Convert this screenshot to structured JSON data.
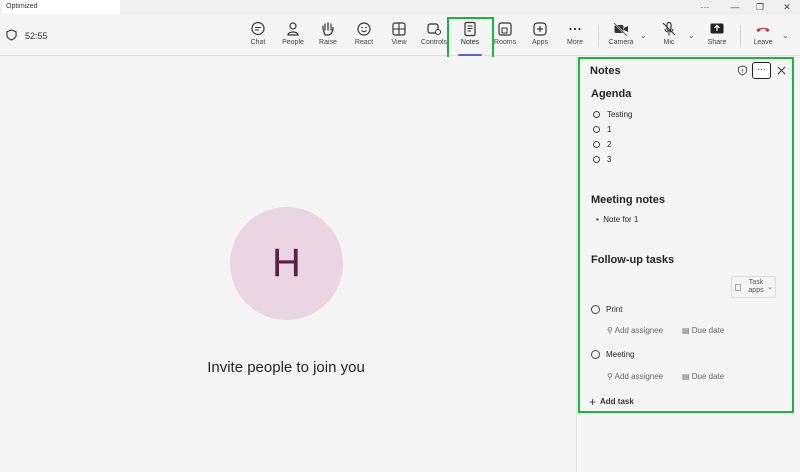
{
  "window": {
    "title": "Optimized",
    "controls": [
      "···",
      "—",
      "❐",
      "✕"
    ]
  },
  "meeting": {
    "timer": "52:55"
  },
  "toolbar": {
    "buttons": [
      {
        "name": "chat",
        "label": "Chat",
        "icon": "chat-icon"
      },
      {
        "name": "people",
        "label": "People",
        "icon": "people-icon"
      },
      {
        "name": "raise",
        "label": "Raise",
        "icon": "hand-icon"
      },
      {
        "name": "react",
        "label": "React",
        "icon": "smile-icon"
      },
      {
        "name": "view",
        "label": "View",
        "icon": "grid-icon"
      },
      {
        "name": "controls",
        "label": "Controls",
        "icon": "controls-icon"
      },
      {
        "name": "notes",
        "label": "Notes",
        "icon": "notes-icon",
        "active": true
      },
      {
        "name": "rooms",
        "label": "Rooms",
        "icon": "rooms-icon"
      },
      {
        "name": "apps",
        "label": "Apps",
        "icon": "plus-icon"
      },
      {
        "name": "more",
        "label": "More",
        "icon": "ellipsis-icon"
      },
      {
        "name": "camera",
        "label": "Camera",
        "icon": "camera-off-icon"
      },
      {
        "name": "mic",
        "label": "Mic",
        "icon": "mic-off-icon"
      },
      {
        "name": "share",
        "label": "Share",
        "icon": "share-icon"
      },
      {
        "name": "leave",
        "label": "Leave",
        "icon": "phone-icon"
      }
    ],
    "accent": "#5b5fc7",
    "leave_color": "#c4314b"
  },
  "stage": {
    "avatar_initial": "H",
    "invite_text": "Invite people to join you",
    "avatar_bg": "#ead5e3",
    "avatar_fg": "#5c1f47"
  },
  "notes": {
    "title": "Notes",
    "more": "···",
    "agenda": {
      "title": "Agenda",
      "items": [
        "Testing",
        "1",
        "2",
        "3"
      ]
    },
    "meeting_notes": {
      "title": "Meeting notes",
      "items": [
        "Note for 1"
      ]
    },
    "followup": {
      "title": "Follow-up tasks",
      "task_apps": "Task apps",
      "tasks": [
        {
          "name": "Print",
          "assignee": "Add assignee",
          "due": "Due date"
        },
        {
          "name": "Meeting",
          "assignee": "Add assignee",
          "due": "Due date"
        }
      ],
      "add_task": "Add task"
    }
  },
  "highlight_color": "#1db43b"
}
